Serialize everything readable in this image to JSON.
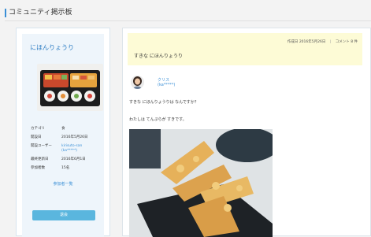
{
  "header": {
    "title": "コミュニティ掲示板"
  },
  "sidebar": {
    "title": "にほんりょうり",
    "info": [
      {
        "key": "カテゴリ",
        "value": "食"
      },
      {
        "key": "開設日",
        "value": "2016年5月26日"
      },
      {
        "key": "開設ユーザー",
        "value": "kirisuto-san",
        "value2": "(ka*****)"
      },
      {
        "key": "最終更新日",
        "value": "2016年6月1日"
      },
      {
        "key": "参加者数",
        "value": "15名"
      }
    ],
    "members_link": "参加者一覧",
    "join_button": "退会"
  },
  "post": {
    "created_label": "作成日",
    "created_date": "2016年5月26日",
    "separator": "|",
    "comments": "コメント 8 件",
    "title": "すきな にほんりょうり",
    "author_name": "クリス",
    "author_id": "(ka*****)",
    "body_line1": "すきな にほんりょうりは なんですか？",
    "body_line2": "わたしは てんぷらが すきです。"
  }
}
